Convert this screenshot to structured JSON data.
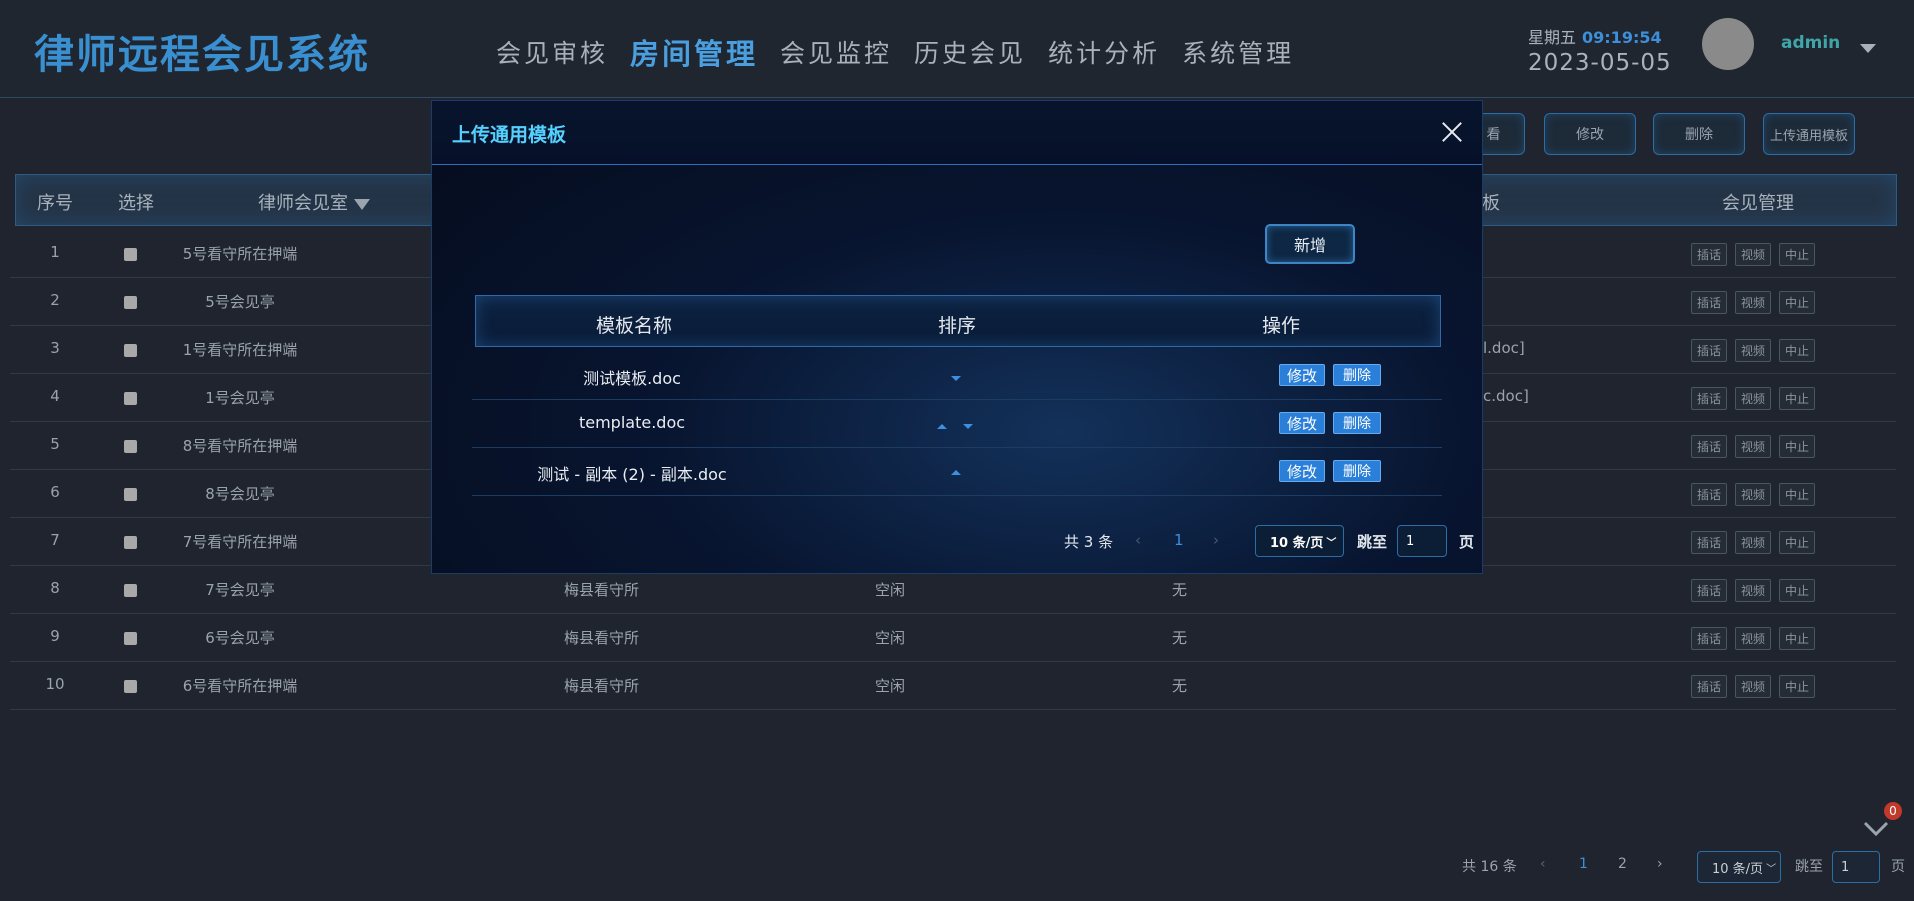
{
  "header": {
    "app_title": "律师远程会见系统",
    "nav": [
      "会见审核",
      "房间管理",
      "会见监控",
      "历史会见",
      "统计分析",
      "系统管理"
    ],
    "active_nav": "房间管理",
    "weekday": "星期五",
    "time": "09:19:54",
    "date": "2023-05-05",
    "username": "admin"
  },
  "toolbar": {
    "view_label": "看",
    "edit_label": "修改",
    "delete_label": "删除",
    "upload_label": "上传通用模板"
  },
  "table": {
    "headers": [
      "序号",
      "选择",
      "律师会见室",
      "板",
      "会见管理"
    ],
    "rows": [
      {
        "no": "1",
        "room": "5号看守所在押端",
        "col3": "",
        "col4": "",
        "col5": "",
        "tpl": ""
      },
      {
        "no": "2",
        "room": "5号会见亭",
        "col3": "",
        "col4": "",
        "col5": "",
        "tpl": ""
      },
      {
        "no": "3",
        "room": "1号看守所在押端",
        "col3": "",
        "col4": "",
        "col5": "",
        "tpl": "l.doc]"
      },
      {
        "no": "4",
        "room": "1号会见亭",
        "col3": "",
        "col4": "",
        "col5": "",
        "tpl": "c.doc]"
      },
      {
        "no": "5",
        "room": "8号看守所在押端",
        "col3": "",
        "col4": "",
        "col5": "",
        "tpl": ""
      },
      {
        "no": "6",
        "room": "8号会见亭",
        "col3": "",
        "col4": "",
        "col5": "",
        "tpl": ""
      },
      {
        "no": "7",
        "room": "7号看守所在押端",
        "col3": "",
        "col4": "",
        "col5": "",
        "tpl": ""
      },
      {
        "no": "8",
        "room": "7号会见亭",
        "col3": "梅县看守所",
        "col4": "空闲",
        "col5": "无",
        "tpl": ""
      },
      {
        "no": "9",
        "room": "6号会见亭",
        "col3": "梅县看守所",
        "col4": "空闲",
        "col5": "无",
        "tpl": ""
      },
      {
        "no": "10",
        "room": "6号看守所在押端",
        "col3": "梅县看守所",
        "col4": "空闲",
        "col5": "无",
        "tpl": ""
      }
    ],
    "row_actions": [
      "插话",
      "视频",
      "中止"
    ]
  },
  "pager": {
    "total": "共 16 条",
    "pages": [
      "1",
      "2"
    ],
    "current": "1",
    "size": "10 条/页",
    "jump_label": "跳至",
    "jump_value": "1",
    "page_suffix": "页"
  },
  "notification_count": "0",
  "modal": {
    "title": "上传通用模板",
    "add_label": "新增",
    "headers": [
      "模板名称",
      "排序",
      "操作"
    ],
    "rows": [
      {
        "name": "测试模板.doc",
        "sort": "down"
      },
      {
        "name": "template.doc",
        "sort": "both"
      },
      {
        "name": "测试 - 副本 (2) - 副本.doc",
        "sort": "up"
      }
    ],
    "edit_label": "修改",
    "delete_label": "删除",
    "pager": {
      "total": "共 3 条",
      "current": "1",
      "size": "10 条/页",
      "jump_label": "跳至",
      "jump_value": "1",
      "page_suffix": "页"
    }
  }
}
